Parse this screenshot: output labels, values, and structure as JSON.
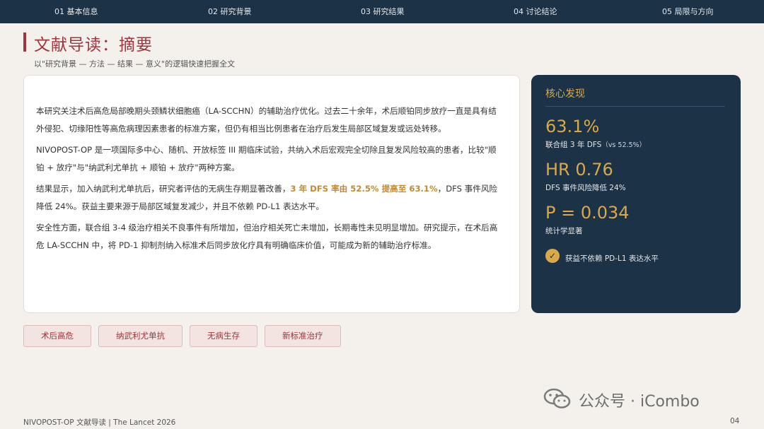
{
  "nav": {
    "items": [
      "01 基本信息",
      "02 研究背景",
      "03 研究结果",
      "04 讨论结论",
      "05 局限与方向"
    ]
  },
  "header": {
    "title": "文献导读：摘要",
    "subtitle": "以\"研究背景 — 方法 — 结果 — 意义\"的逻辑快速把握全文"
  },
  "main": {
    "p1": "本研究关注术后高危局部晚期头颈鳞状细胞癌（LA-SCCHN）的辅助治疗优化。过去二十余年，术后顺铂同步放疗一直是具有结外侵犯、切缘阳性等高危病理因素患者的标准方案，但仍有相当比例患者在治疗后发生局部区域复发或远处转移。",
    "p2": "NIVOPOST-OP 是一项国际多中心、随机、开放标签 III 期临床试验，共纳入术后宏观完全切除且复发风险较高的患者，比较\"顺铂 + 放疗\"与\"纳武利尤单抗 + 顺铂 + 放疗\"两种方案。",
    "p3_before": "结果显示，加入纳武利尤单抗后，研究者评估的无病生存期显著改善，",
    "p3_highlight": "3 年 DFS 率由 52.5% 提高至 63.1%",
    "p3_after": "，DFS 事件风险降低 24%。获益主要来源于局部区域复发减少，并且不依赖 PD-L1 表达水平。",
    "p4": "安全性方面，联合组 3-4 级治疗相关不良事件有所增加，但治疗相关死亡未增加，长期毒性未见明显增加。研究提示，在术后高危 LA-SCCHN 中，将 PD-1 抑制剂纳入标准术后同步放化疗具有明确临床价值，可能成为新的辅助治疗标准。"
  },
  "side": {
    "title": "核心发现",
    "stat1_value": "63.1%",
    "stat1_desc": "联合组 3 年 DFS",
    "stat1_note": "（vs 52.5%）",
    "stat2_value": "HR 0.76",
    "stat2_desc": "DFS 事件风险降低 24%",
    "stat3_value": "P = 0.034",
    "stat3_desc": "统计学显著",
    "check_text": "获益不依赖 PD-L1 表达水平"
  },
  "tags": [
    "术后高危",
    "纳武利尤单抗",
    "无病生存",
    "新标准治疗"
  ],
  "watermark": {
    "text": "公众号 · iCombo"
  },
  "footer": {
    "left": "NIVOPOST-OP 文献导读 | The Lancet 2026",
    "page": "04"
  },
  "colors": {
    "navy": "#1c3347",
    "accent_red": "#a0353d",
    "gold": "#d9a847",
    "highlight": "#c48a2c"
  }
}
